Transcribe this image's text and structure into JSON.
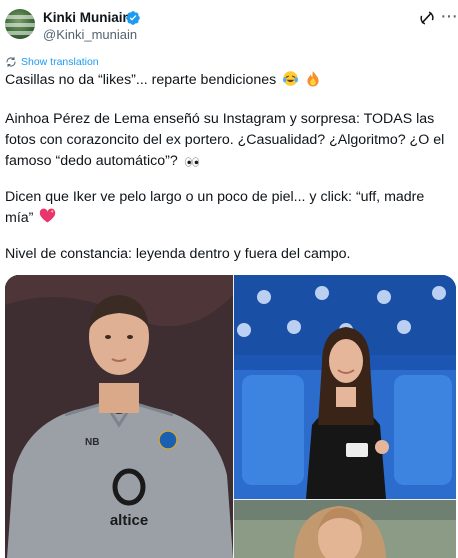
{
  "author": {
    "display_name": "Kinki Muniain",
    "handle": "@Kinki_muniain"
  },
  "translate_label": "Show translation",
  "paragraphs": [
    "Casillas no da “likes”... reparte bendiciones",
    "Ainhoa Pérez de Lema enseñó su Instagram y sorpresa: TODAS las fotos con corazoncito del ex portero. ¿Casualidad? ¿Algoritmo? ¿O el famoso “dedo automático”?",
    "Dicen que Iker ve pelo largo o un poco de piel... y click: “uff, madre mía”",
    "Nivel de constancia: leyenda dentro y fuera del campo."
  ],
  "media": {
    "photo_left_text": {
      "brand": "NB",
      "sponsor": "altice"
    }
  },
  "colors": {
    "verified": "#1d9bf0",
    "link": "#1d9bf0",
    "secondary_text": "#536471",
    "jersey": "#9aa0a6",
    "stadium_seats": "#2a63c2"
  },
  "icons": [
    "verified-badge-icon",
    "grok-icon",
    "more-options-icon",
    "translate-icon"
  ]
}
